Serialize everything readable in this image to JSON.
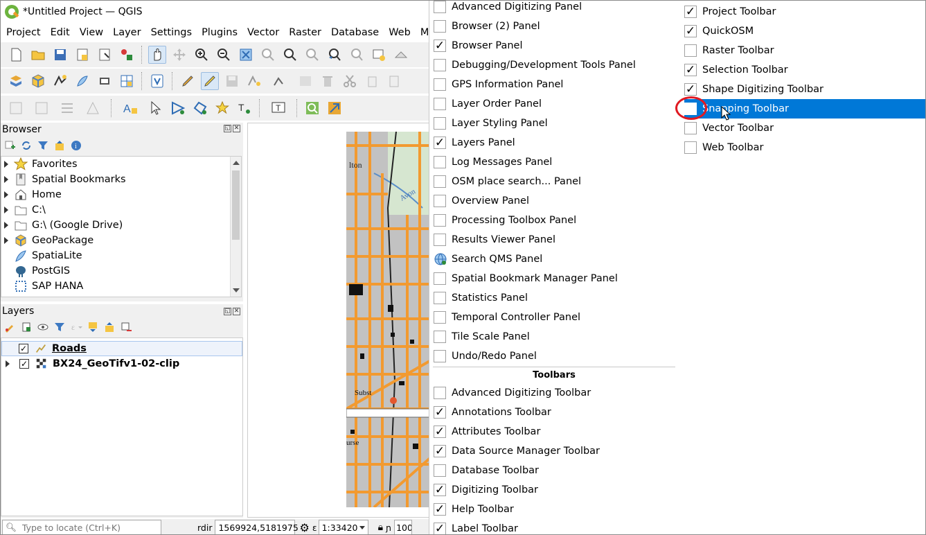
{
  "window": {
    "title": "*Untitled Project — QGIS"
  },
  "menubar": {
    "items": [
      "Project",
      "Edit",
      "View",
      "Layer",
      "Settings",
      "Plugins",
      "Vector",
      "Raster",
      "Database",
      "Web",
      "Mesh"
    ]
  },
  "browser": {
    "title": "Browser",
    "items": [
      {
        "label": "Favorites",
        "icon": "star-icon",
        "expandable": true
      },
      {
        "label": "Spatial Bookmarks",
        "icon": "bookmark-icon",
        "expandable": true
      },
      {
        "label": "Home",
        "icon": "home-icon",
        "expandable": true
      },
      {
        "label": "C:\\",
        "icon": "folder-icon",
        "expandable": true
      },
      {
        "label": "G:\\ (Google Drive)",
        "icon": "folder-icon",
        "expandable": true
      },
      {
        "label": "GeoPackage",
        "icon": "geopackage-icon",
        "expandable": true
      },
      {
        "label": "SpatiaLite",
        "icon": "spatialite-icon",
        "expandable": false
      },
      {
        "label": "PostGIS",
        "icon": "postgis-icon",
        "expandable": false
      },
      {
        "label": "SAP HANA",
        "icon": "sap-hana-icon",
        "expandable": false
      }
    ]
  },
  "layers": {
    "title": "Layers",
    "items": [
      {
        "label": "Roads",
        "checked": true,
        "selected": true
      },
      {
        "label": "BX24_GeoTifv1-02-clip",
        "checked": true,
        "selected": false
      }
    ]
  },
  "statusbar": {
    "locator_placeholder": "Type to locate (Ctrl+K)",
    "coordinate_label": "rdir",
    "coordinate": "1569924,5181975",
    "scale_label": "ɛ",
    "scale": "1:33420",
    "magnifier_label": "ɲ",
    "magnifier": "100"
  },
  "context_menu": {
    "panels": [
      {
        "label": "Advanced Digitizing Panel",
        "checked": false
      },
      {
        "label": "Browser (2) Panel",
        "checked": false
      },
      {
        "label": "Browser Panel",
        "checked": true
      },
      {
        "label": "Debugging/Development Tools Panel",
        "checked": false
      },
      {
        "label": "GPS Information Panel",
        "checked": false
      },
      {
        "label": "Layer Order Panel",
        "checked": false
      },
      {
        "label": "Layer Styling Panel",
        "checked": false
      },
      {
        "label": "Layers Panel",
        "checked": true
      },
      {
        "label": "Log Messages Panel",
        "checked": false
      },
      {
        "label": "OSM place search... Panel",
        "checked": false
      },
      {
        "label": "Overview Panel",
        "checked": false
      },
      {
        "label": "Processing Toolbox Panel",
        "checked": false
      },
      {
        "label": "Results Viewer Panel",
        "checked": false
      },
      {
        "label": "Search QMS Panel",
        "checked": false,
        "icon": "globe-icon"
      },
      {
        "label": "Spatial Bookmark Manager Panel",
        "checked": false
      },
      {
        "label": "Statistics Panel",
        "checked": false
      },
      {
        "label": "Temporal Controller Panel",
        "checked": false
      },
      {
        "label": "Tile Scale Panel",
        "checked": false
      },
      {
        "label": "Undo/Redo Panel",
        "checked": false
      }
    ],
    "toolbars_header": "Toolbars",
    "toolbars_col1": [
      {
        "label": "Advanced Digitizing Toolbar",
        "checked": false
      },
      {
        "label": "Annotations Toolbar",
        "checked": true
      },
      {
        "label": "Attributes Toolbar",
        "checked": true
      },
      {
        "label": "Data Source Manager Toolbar",
        "checked": true
      },
      {
        "label": "Database Toolbar",
        "checked": false
      },
      {
        "label": "Digitizing Toolbar",
        "checked": true
      },
      {
        "label": "Help Toolbar",
        "checked": true
      },
      {
        "label": "Label Toolbar",
        "checked": true
      }
    ],
    "toolbars_col2": [
      {
        "label": "Project Toolbar",
        "checked": true
      },
      {
        "label": "QuickOSM",
        "checked": true
      },
      {
        "label": "Raster Toolbar",
        "checked": false
      },
      {
        "label": "Selection Toolbar",
        "checked": true
      },
      {
        "label": "Shape Digitizing Toolbar",
        "checked": true
      },
      {
        "label": "Snapping Toolbar",
        "checked": false,
        "highlighted": true
      },
      {
        "label": "Vector Toolbar",
        "checked": false
      },
      {
        "label": "Web Toolbar",
        "checked": false
      }
    ]
  },
  "map_labels": [
    "lton",
    "Avon",
    "Subst",
    "urse"
  ],
  "colors": {
    "highlight": "#0078d7",
    "annotation_circle": "#e01a22",
    "road_orange": "#f29a30"
  }
}
